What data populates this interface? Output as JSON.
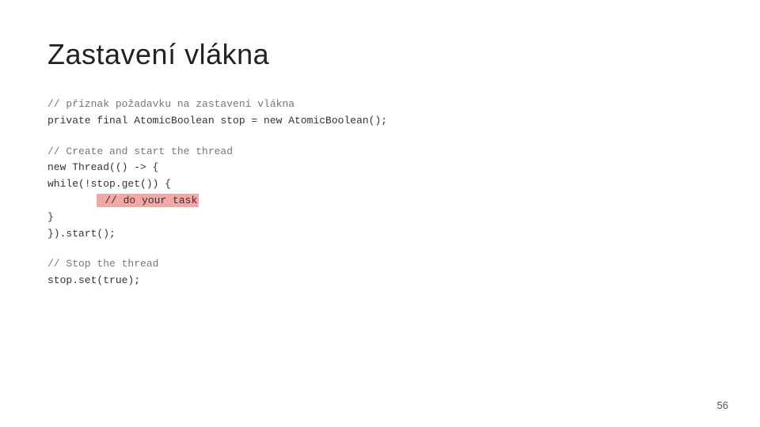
{
  "slide": {
    "title": "Zastavení vlákna",
    "page_number": "56",
    "code": {
      "section1": {
        "comment": "// příznak požadavku na zastavení vlákna",
        "line1": "private final AtomicBoolean stop = new AtomicBoolean();"
      },
      "section2": {
        "comment": "// Create and start the thread",
        "line1": "new Thread(() -> {",
        "line2": "    while(!stop.get()) {",
        "line3_highlighted": "        // do your task",
        "line4": "    }",
        "line5": "}).start();"
      },
      "section3": {
        "comment": "// Stop the thread",
        "line1": "stop.set(true);"
      }
    }
  }
}
